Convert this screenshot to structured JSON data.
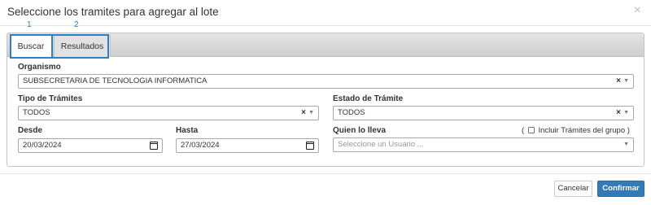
{
  "modal": {
    "title": "Seleccione los tramites para agregar al lote",
    "close": "×"
  },
  "markers": [
    "1",
    "2"
  ],
  "tabs": [
    {
      "label": "Buscar",
      "active": true
    },
    {
      "label": "Resultados",
      "active": false
    }
  ],
  "form": {
    "organismo": {
      "label": "Organismo",
      "value": "SUBSECRETARIA DE TECNOLOGIA INFORMATICA"
    },
    "tipo_tramites": {
      "label": "Tipo de Trámites",
      "value": "TODOS"
    },
    "estado_tramite": {
      "label": "Estado de Trámite",
      "value": "TODOS"
    },
    "desde": {
      "label": "Desde",
      "value": "20/03/2024"
    },
    "hasta": {
      "label": "Hasta",
      "value": "27/03/2024"
    },
    "quien_lo_lleva": {
      "label": "Quien lo lleva",
      "placeholder": "Seleccione un Usuario ..."
    },
    "incluir_grupo": {
      "open": "(",
      "label": "Incluir Trámites del grupo",
      "close": ")",
      "checked": false
    }
  },
  "buttons": {
    "cancel": "Cancelar",
    "confirm": "Confirmar"
  },
  "icons": {
    "clear": "×",
    "arrow": "▼"
  },
  "colors": {
    "accent": "#337ab7",
    "highlight": "#2f7fc1"
  }
}
